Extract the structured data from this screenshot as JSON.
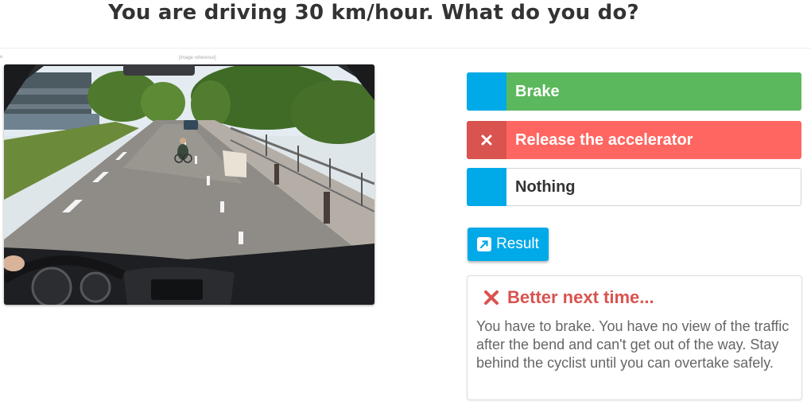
{
  "question": "You are driving 30 km/hour. What do you do?",
  "image_corner_marks": {
    "left": "e",
    "top": "[image reference]"
  },
  "options": [
    {
      "label": "Brake",
      "state": "correct"
    },
    {
      "label": "Release the accelerator",
      "state": "selected-wrong"
    },
    {
      "label": "Nothing",
      "state": "neutral"
    }
  ],
  "result_button": {
    "label": "Result",
    "icon": "external-link-icon"
  },
  "feedback": {
    "icon": "cross-icon",
    "heading": "Better next time...",
    "text": "You have to brake. You have no view of the traffic after the bend and can't get out of the way. Stay behind the cyclist until you can overtake safely."
  },
  "colors": {
    "correct": "#5cb85c",
    "wrong": "#ff6661",
    "wrong_marker": "#d9534f",
    "accent": "#00a9e7",
    "heading_text": "#333333",
    "body_text": "#666666"
  }
}
